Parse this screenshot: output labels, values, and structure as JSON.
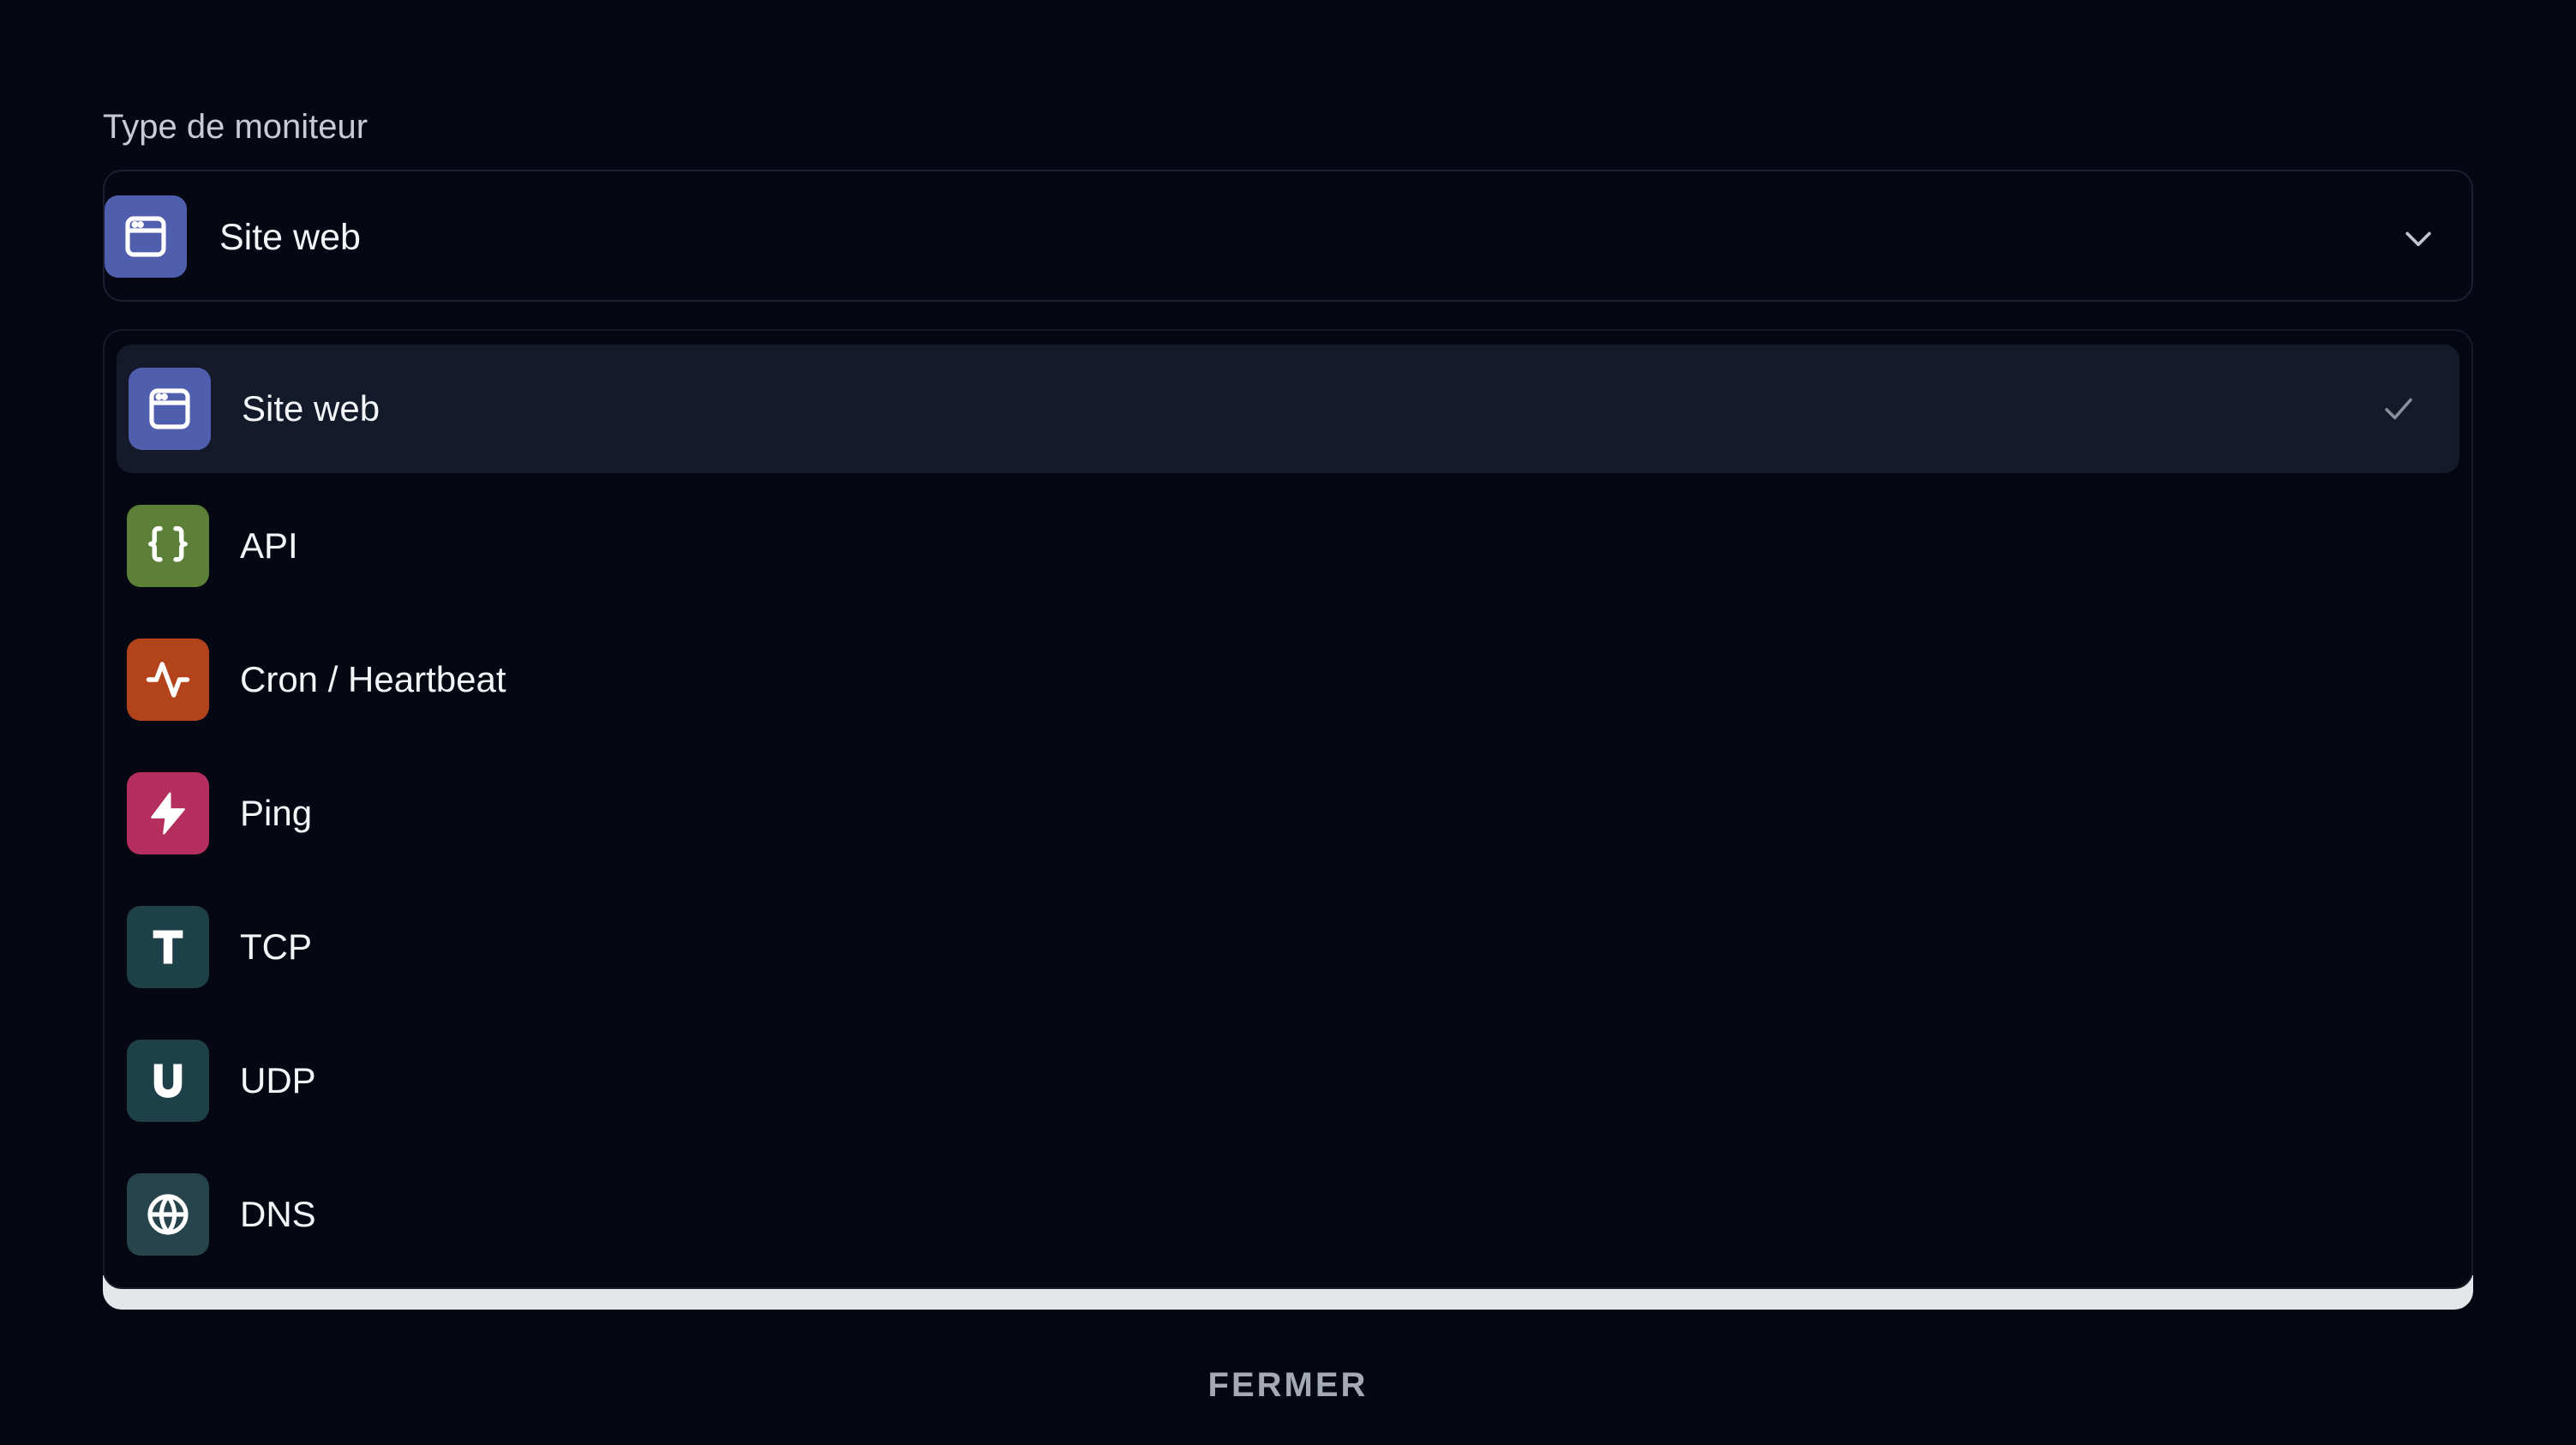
{
  "field": {
    "label": "Type de moniteur",
    "selected_value": "Site web",
    "selected_icon": "browser-window-icon"
  },
  "options": [
    {
      "label": "Site web",
      "icon": "browser-window-icon",
      "color": "#4f5fae",
      "selected": true
    },
    {
      "label": "API",
      "icon": "braces-icon",
      "color": "#5c8038",
      "selected": false
    },
    {
      "label": "Cron / Heartbeat",
      "icon": "activity-icon",
      "color": "#b2431b",
      "selected": false
    },
    {
      "label": "Ping",
      "icon": "lightning-icon",
      "color": "#b42f5d",
      "selected": false
    },
    {
      "label": "TCP",
      "icon": "letter-t-icon",
      "color": "#1e4048",
      "selected": false
    },
    {
      "label": "UDP",
      "icon": "letter-u-icon",
      "color": "#1e4048",
      "selected": false
    },
    {
      "label": "DNS",
      "icon": "globe-icon",
      "color": "#27434b",
      "selected": false
    }
  ],
  "close_button": {
    "label": "FERMER"
  }
}
